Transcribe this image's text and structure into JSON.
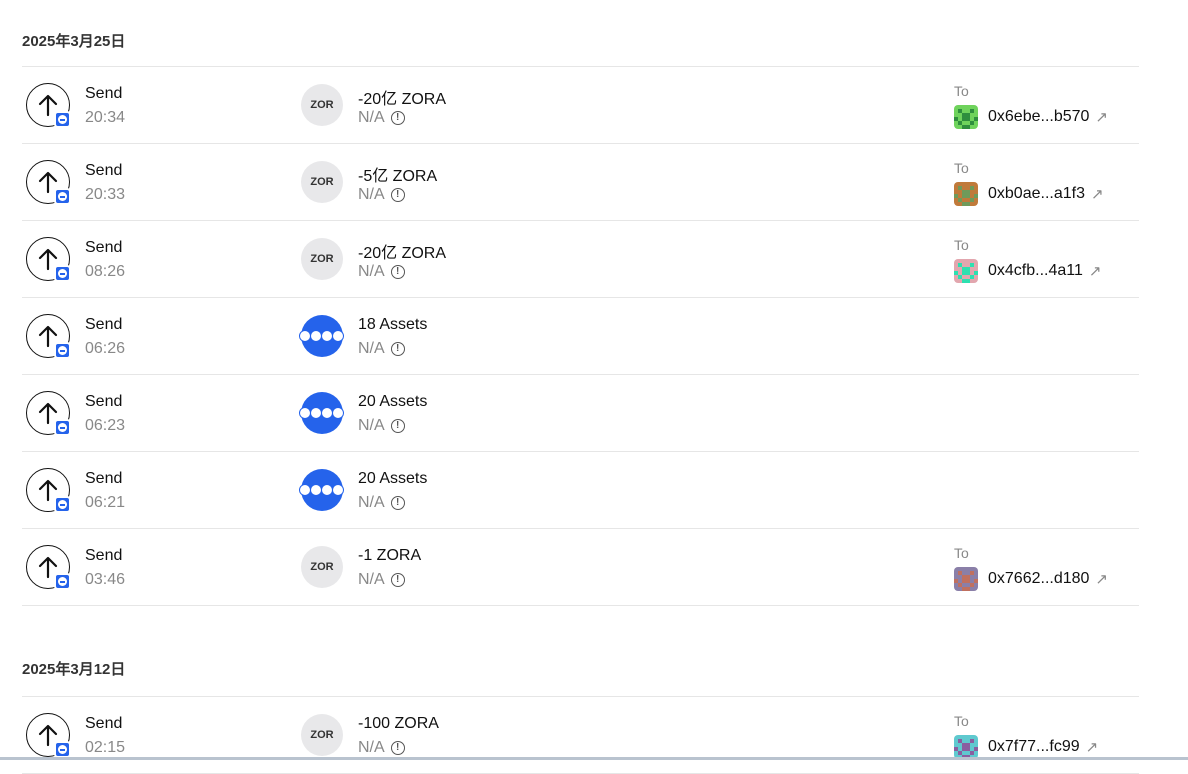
{
  "groups": [
    {
      "date": "2025年3月25日",
      "rows": [
        {
          "type": "Send",
          "time": "20:34",
          "token": "ZOR",
          "token_kind": "single",
          "amount": "-20亿 ZORA",
          "value": "N/A",
          "to_label": "To",
          "address": "0x6ebe...b570",
          "avatar_colors": [
            "#6fd35c",
            "#2f8f3e"
          ]
        },
        {
          "type": "Send",
          "time": "20:33",
          "token": "ZOR",
          "token_kind": "single",
          "amount": "-5亿 ZORA",
          "value": "N/A",
          "to_label": "To",
          "address": "0xb0ae...a1f3",
          "avatar_colors": [
            "#c07a3a",
            "#6f9a5a"
          ]
        },
        {
          "type": "Send",
          "time": "08:26",
          "token": "ZOR",
          "token_kind": "single",
          "amount": "-20亿 ZORA",
          "value": "N/A",
          "to_label": "To",
          "address": "0x4cfb...4a11",
          "avatar_colors": [
            "#e2a6ae",
            "#2de0b0"
          ]
        },
        {
          "type": "Send",
          "time": "06:26",
          "token": "",
          "token_kind": "multi",
          "amount": "18 Assets",
          "value": "N/A",
          "to_label": "",
          "address": "",
          "avatar_colors": []
        },
        {
          "type": "Send",
          "time": "06:23",
          "token": "",
          "token_kind": "multi",
          "amount": "20 Assets",
          "value": "N/A",
          "to_label": "",
          "address": "",
          "avatar_colors": []
        },
        {
          "type": "Send",
          "time": "06:21",
          "token": "",
          "token_kind": "multi",
          "amount": "20 Assets",
          "value": "N/A",
          "to_label": "",
          "address": "",
          "avatar_colors": []
        },
        {
          "type": "Send",
          "time": "03:46",
          "token": "ZOR",
          "token_kind": "single",
          "amount": "-1 ZORA",
          "value": "N/A",
          "to_label": "To",
          "address": "0x7662...d180",
          "avatar_colors": [
            "#8a7fa8",
            "#c0705f"
          ]
        }
      ]
    },
    {
      "date": "2025年3月12日",
      "rows": [
        {
          "type": "Send",
          "time": "02:15",
          "token": "ZOR",
          "token_kind": "single",
          "amount": "-100 ZORA",
          "value": "N/A",
          "to_label": "To",
          "address": "0x7f77...fc99",
          "avatar_colors": [
            "#5fc9cf",
            "#8a5fa0"
          ]
        }
      ]
    }
  ],
  "icons": {
    "direction": "arrow-up-icon",
    "chain": "base-chain-icon",
    "info": "info-icon",
    "external": "external-link-icon"
  },
  "colors": {
    "accent": "#2563eb",
    "muted": "#888888",
    "divider": "#e6e6e6"
  }
}
